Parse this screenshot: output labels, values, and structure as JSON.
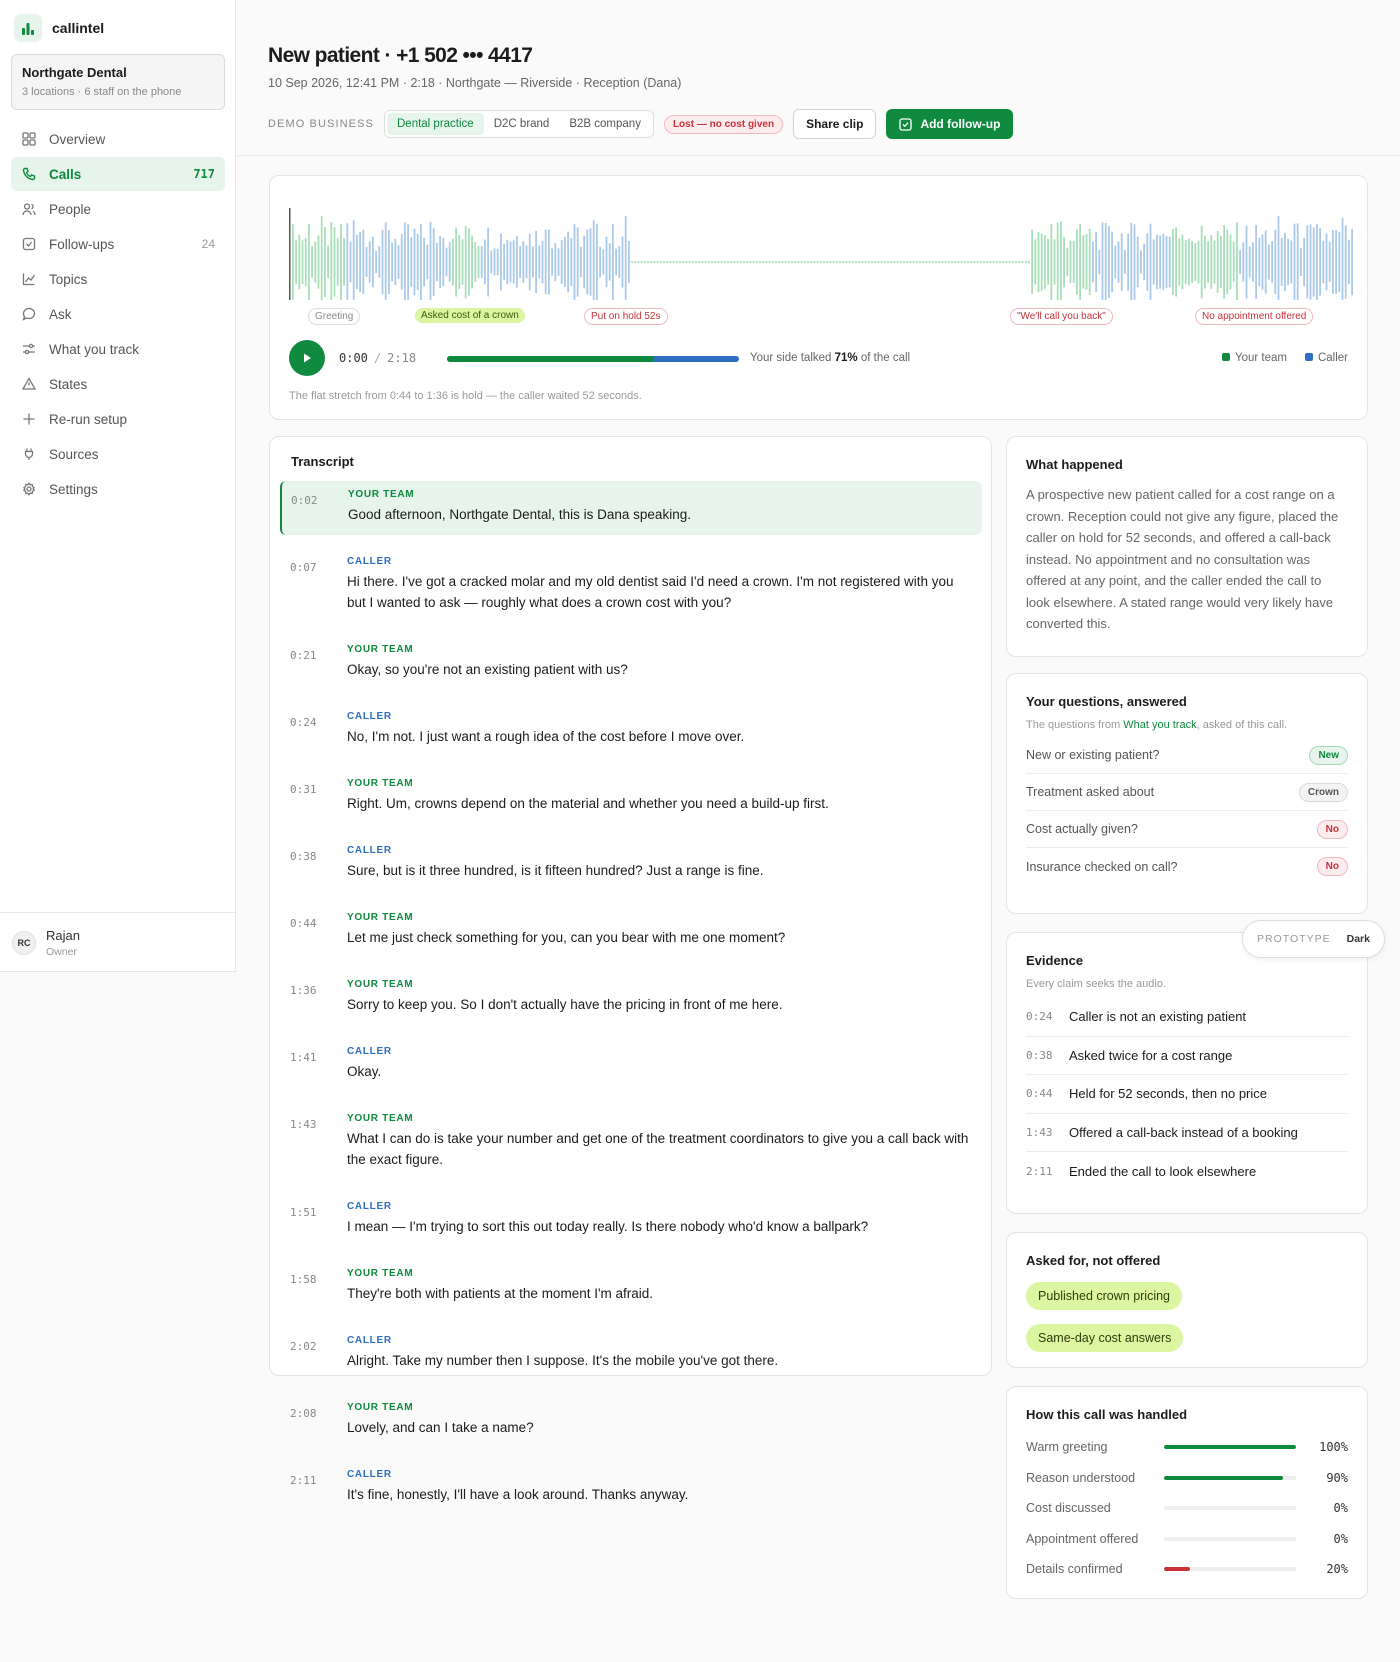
{
  "brand": {
    "name": "callintel"
  },
  "org": {
    "name": "Northgate Dental",
    "sub": "3 locations · 6 staff on the phone"
  },
  "nav": [
    {
      "label": "Overview",
      "count": "",
      "icon": "grid-icon"
    },
    {
      "label": "Calls",
      "count": "717",
      "icon": "phone-icon",
      "active": true
    },
    {
      "label": "People",
      "count": "",
      "icon": "people-icon"
    },
    {
      "label": "Follow-ups",
      "count": "24",
      "icon": "checkbox-icon"
    },
    {
      "label": "Topics",
      "count": "",
      "icon": "chart-line-icon"
    },
    {
      "label": "Ask",
      "count": "",
      "icon": "chat-bubble-icon"
    },
    {
      "label": "What you track",
      "count": "",
      "icon": "sliders-icon"
    },
    {
      "label": "States",
      "count": "",
      "icon": "warning-triangle-icon"
    },
    {
      "label": "Re-run setup",
      "count": "",
      "icon": "plus-icon"
    },
    {
      "label": "Sources",
      "count": "",
      "icon": "plug-icon"
    },
    {
      "label": "Settings",
      "count": "",
      "icon": "gear-icon"
    }
  ],
  "user": {
    "initials": "RC",
    "name": "Rajan",
    "role": "Owner"
  },
  "header": {
    "title": "New patient · +1 502 ••• 4417",
    "subtitle": "10 Sep 2026, 12:41 PM · 2:18 · Northgate — Riverside · Reception (Dana)",
    "demo_label": "DEMO BUSINESS",
    "segments": [
      "Dental practice",
      "D2C brand",
      "B2B company"
    ],
    "segment_selected": "Dental practice",
    "status_pill": "Lost — no cost given",
    "share_label": "Share clip",
    "add_label": "Add follow-up"
  },
  "player": {
    "markers": [
      {
        "label": "Greeting",
        "style": "grey"
      },
      {
        "label": "Asked cost of a crown",
        "style": "lime"
      },
      {
        "label": "Put on hold 52s",
        "style": "red"
      },
      {
        "label": "\"We'll call you back\"",
        "style": "red"
      },
      {
        "label": "No appointment offered",
        "style": "red"
      }
    ],
    "current": "0:00",
    "separator": "/",
    "total": "2:18",
    "talk_prefix": "Your side talked",
    "talk_pct": "71%",
    "talk_suffix": "of the call",
    "talk_fraction": 0.71,
    "legend": [
      {
        "label": "Your team",
        "color": "#0f8a3e"
      },
      {
        "label": "Caller",
        "color": "#2f6fc0"
      }
    ],
    "hold_note": "The flat stretch from 0:44 to 1:36 is hold — the caller waited 52 seconds."
  },
  "transcript": {
    "title": "Transcript",
    "turns": [
      {
        "ts": "0:02",
        "speaker": "YOUR TEAM",
        "role": "team",
        "text": "Good afternoon, Northgate Dental, this is Dana speaking."
      },
      {
        "ts": "0:07",
        "speaker": "CALLER",
        "role": "caller",
        "text": "Hi there. I've got a cracked molar and my old dentist said I'd need a crown. I'm not registered with you but I wanted to ask — roughly what does a crown cost with you?"
      },
      {
        "ts": "0:21",
        "speaker": "YOUR TEAM",
        "role": "team",
        "text": "Okay, so you're not an existing patient with us?"
      },
      {
        "ts": "0:24",
        "speaker": "CALLER",
        "role": "caller",
        "text": "No, I'm not. I just want a rough idea of the cost before I move over."
      },
      {
        "ts": "0:31",
        "speaker": "YOUR TEAM",
        "role": "team",
        "text": "Right. Um, crowns depend on the material and whether you need a build-up first."
      },
      {
        "ts": "0:38",
        "speaker": "CALLER",
        "role": "caller",
        "text": "Sure, but is it three hundred, is it fifteen hundred? Just a range is fine."
      },
      {
        "ts": "0:44",
        "speaker": "YOUR TEAM",
        "role": "team",
        "text": "Let me just check something for you, can you bear with me one moment?"
      },
      {
        "ts": "1:36",
        "speaker": "YOUR TEAM",
        "role": "team",
        "text": "Sorry to keep you. So I don't actually have the pricing in front of me here."
      },
      {
        "ts": "1:41",
        "speaker": "CALLER",
        "role": "caller",
        "text": "Okay."
      },
      {
        "ts": "1:43",
        "speaker": "YOUR TEAM",
        "role": "team",
        "text": "What I can do is take your number and get one of the treatment coordinators to give you a call back with the exact figure."
      },
      {
        "ts": "1:51",
        "speaker": "CALLER",
        "role": "caller",
        "text": "I mean — I'm trying to sort this out today really. Is there nobody who'd know a ballpark?"
      },
      {
        "ts": "1:58",
        "speaker": "YOUR TEAM",
        "role": "team",
        "text": "They're both with patients at the moment I'm afraid."
      },
      {
        "ts": "2:02",
        "speaker": "CALLER",
        "role": "caller",
        "text": "Alright. Take my number then I suppose. It's the mobile you've got there."
      },
      {
        "ts": "2:08",
        "speaker": "YOUR TEAM",
        "role": "team",
        "text": "Lovely, and can I take a name?"
      },
      {
        "ts": "2:11",
        "speaker": "CALLER",
        "role": "caller",
        "text": "It's fine, honestly, I'll have a look around. Thanks anyway."
      }
    ]
  },
  "what_happened": {
    "title": "What happened",
    "body": "A prospective new patient called for a cost range on a crown. Reception could not give any figure, placed the caller on hold for 52 seconds, and offered a call-back instead. No appointment and no consultation was offered at any point, and the caller ended the call to look elsewhere. A stated range would very likely have converted this."
  },
  "questions": {
    "title": "Your questions, answered",
    "sub_prefix": "The questions from ",
    "sub_link": "What you track",
    "sub_suffix": ", asked of this call.",
    "rows": [
      {
        "q": "New or existing patient?",
        "a": "New",
        "style": "new"
      },
      {
        "q": "Treatment asked about",
        "a": "Crown",
        "style": "neutral"
      },
      {
        "q": "Cost actually given?",
        "a": "No",
        "style": "no"
      },
      {
        "q": "Insurance checked on call?",
        "a": "No",
        "style": "no"
      }
    ]
  },
  "prototype": {
    "label": "PROTOTYPE",
    "value": "Dark"
  },
  "evidence": {
    "title": "Evidence",
    "sub": "Every claim seeks the audio.",
    "rows": [
      {
        "ts": "0:24",
        "text": "Caller is not an existing patient"
      },
      {
        "ts": "0:38",
        "text": "Asked twice for a cost range"
      },
      {
        "ts": "0:44",
        "text": "Held for 52 seconds, then no price"
      },
      {
        "ts": "1:43",
        "text": "Offered a call-back instead of a booking"
      },
      {
        "ts": "2:11",
        "text": "Ended the call to look elsewhere"
      }
    ]
  },
  "asked": {
    "title": "Asked for, not offered",
    "chips": [
      "Published crown pricing",
      "Same-day cost answers"
    ]
  },
  "handled": {
    "title": "How this call was handled",
    "rows": [
      {
        "label": "Warm greeting",
        "pct": "100%",
        "value": 1.0,
        "color": "#0f8a3e"
      },
      {
        "label": "Reason understood",
        "pct": "90%",
        "value": 0.9,
        "color": "#0f8a3e"
      },
      {
        "label": "Cost discussed",
        "pct": "0%",
        "value": 0,
        "color": "#0f8a3e"
      },
      {
        "label": "Appointment offered",
        "pct": "0%",
        "value": 0,
        "color": "#0f8a3e"
      },
      {
        "label": "Details confirmed",
        "pct": "20%",
        "value": 0.2,
        "color": "#c8323a"
      }
    ]
  },
  "colors": {
    "accent": "#0f8a3e",
    "caller": "#2f6fc0",
    "team_wave": "#a8dfb9",
    "caller_wave": "#abc9e8",
    "danger": "#c8323a",
    "lime": "#dcf5a0"
  }
}
